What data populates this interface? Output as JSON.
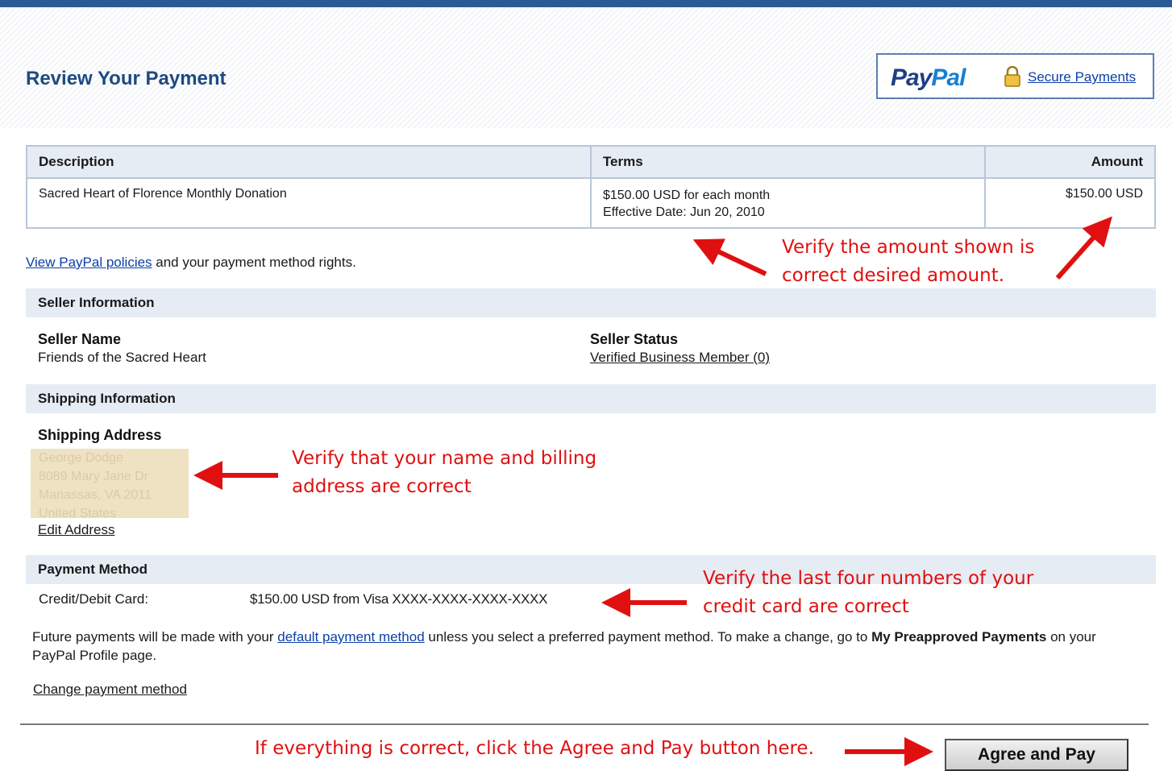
{
  "page": {
    "title": "Review Your Payment",
    "brand": {
      "pay": "Pay",
      "pal": "Pal"
    },
    "secure_link": "Secure Payments"
  },
  "items_table": {
    "headers": [
      "Description",
      "Terms",
      "Amount"
    ],
    "rows": [
      {
        "description": "Sacred Heart of Florence Monthly Donation",
        "terms_line1": "$150.00 USD for each month",
        "terms_line2": "Effective Date: Jun 20, 2010",
        "amount": "$150.00 USD"
      }
    ]
  },
  "policies": {
    "link": "View PayPal policies",
    "suffix": " and your payment method rights."
  },
  "seller": {
    "section": "Seller Information",
    "name_label": "Seller Name",
    "name_value": "Friends of the Sacred Heart",
    "status_label": "Seller Status",
    "status_value": "Verified Business Member (0)"
  },
  "shipping": {
    "section": "Shipping Information",
    "address_label": "Shipping Address",
    "address_lines": [
      "George Dodge",
      "8089 Mary Jane Dr",
      "Manassas, VA 2011",
      "United States"
    ],
    "edit_link": "Edit Address"
  },
  "payment": {
    "section": "Payment Method",
    "label": "Credit/Debit Card:",
    "value": "$150.00 USD from Visa XXXX-XXXX-XXXX-XXXX",
    "future_prefix": "Future payments will be made with your ",
    "future_link": "default payment method",
    "future_middle": " unless you select a preferred payment method. To make a change, go to ",
    "future_bold": "My Preapproved Payments",
    "future_suffix": " on your PayPal Profile page.",
    "change_link": "Change payment method"
  },
  "actions": {
    "agree": "Agree and Pay"
  },
  "annotations": {
    "amount_line1": "Verify the amount shown is",
    "amount_line2": "correct desired amount.",
    "address_line1": "Verify that your name and billing",
    "address_line2": "address are correct",
    "card_line1": "Verify the last four numbers of your",
    "card_line2": "credit card are correct",
    "agree": "If everything is correct, click the Agree and Pay button here."
  },
  "colors": {
    "accent": "#2a5b95",
    "annotation": "#e01010",
    "link": "#0b3fa8",
    "section_bg": "#e6ecf4"
  }
}
